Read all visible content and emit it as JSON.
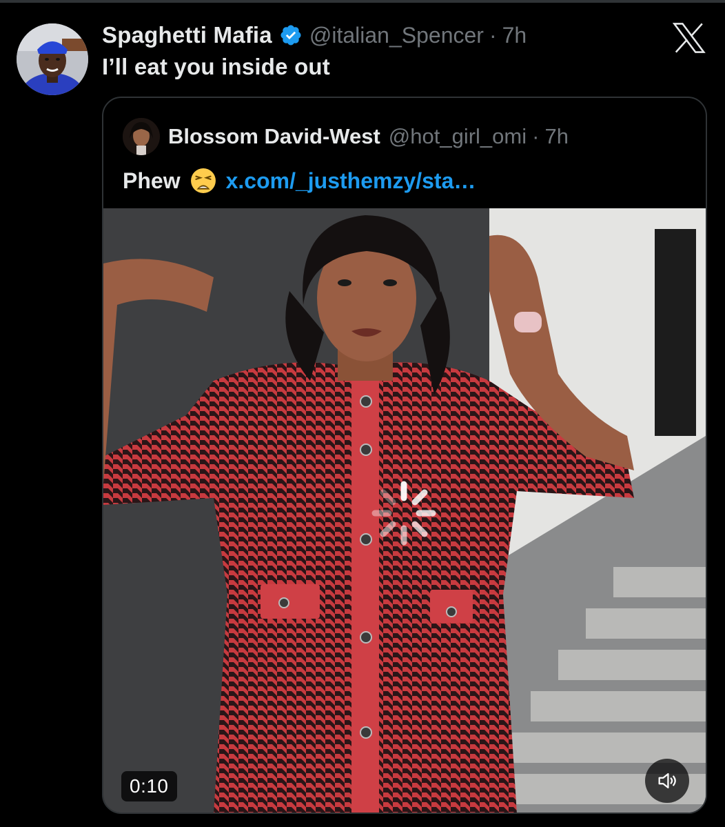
{
  "tweet": {
    "author": {
      "display_name": "Spaghetti Mafia",
      "handle": "@italian_Spencer",
      "time": "7h",
      "verified": true
    },
    "separator": "·",
    "text": "I’ll eat you inside out",
    "brand_icon": "x-logo-icon"
  },
  "quoted_tweet": {
    "author": {
      "display_name": "Blossom David-West",
      "handle": "@hot_girl_omi",
      "time": "7h"
    },
    "separator": "·",
    "text_word": "Phew",
    "emoji": "weary-face-emoji",
    "link": "x.com/_justhemzy/sta…",
    "video": {
      "duration": "0:10",
      "loading": true,
      "mute_icon": "speaker-icon"
    }
  },
  "colors": {
    "background": "#000000",
    "text_primary": "#e7e9ea",
    "text_secondary": "#71767b",
    "link": "#1d9bf0",
    "verified": "#1d9bf0",
    "border": "#2f3336"
  }
}
